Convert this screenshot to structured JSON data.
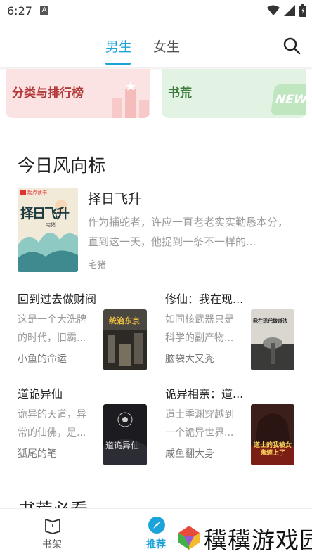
{
  "status_bar": {
    "time": "6:27",
    "notif_letter": "A"
  },
  "header": {
    "tabs": [
      {
        "label": "男生",
        "active": true
      },
      {
        "label": "女生",
        "active": false
      }
    ]
  },
  "cards": {
    "rank_label": "分类与排行榜",
    "library_label": "书荒",
    "library_badge": "NEW"
  },
  "section_title": "今日风向标",
  "featured": {
    "title": "择日飞升",
    "description": "作为捕蛇者，许应一直老老实实勤恳本分，直到这一天，他捉到一条不一样的...",
    "author": "宅猪",
    "cover": {
      "title": "择日飞升",
      "publisher": "起点读书",
      "author": "宅猪"
    }
  },
  "books": [
    {
      "title": "回到过去做财阀",
      "description": "这是一个大洗牌的时代，旧霸...",
      "author": "小鱼的命运",
      "cover_title": "统治东京"
    },
    {
      "title": "修仙：我在现...",
      "description": "如同核武器只是科学的副产物...",
      "author": "脑袋大又秃",
      "cover_title": "我在现代做道法"
    },
    {
      "title": "道诡异仙",
      "description": "诡异的天道，异常的仙佛，是...",
      "author": "狐尾的笔",
      "cover_title": "道诡异仙"
    },
    {
      "title": "诡异相亲：道...",
      "description": "道士季渊穿越到一个诡异世界...",
      "author": "咸鱼翻大身",
      "cover_title": "道士的我被女鬼缠上了"
    }
  ],
  "section2_title": "书荒必看",
  "bottom_nav": {
    "shelf_label": "书架",
    "recommend_label": "推荐"
  },
  "watermark": {
    "text": "䆊䆊游戏园"
  },
  "colors": {
    "accent": "#1ba4d9",
    "rank_card": "#fbe3e3",
    "library_card": "#e3f3e3"
  }
}
